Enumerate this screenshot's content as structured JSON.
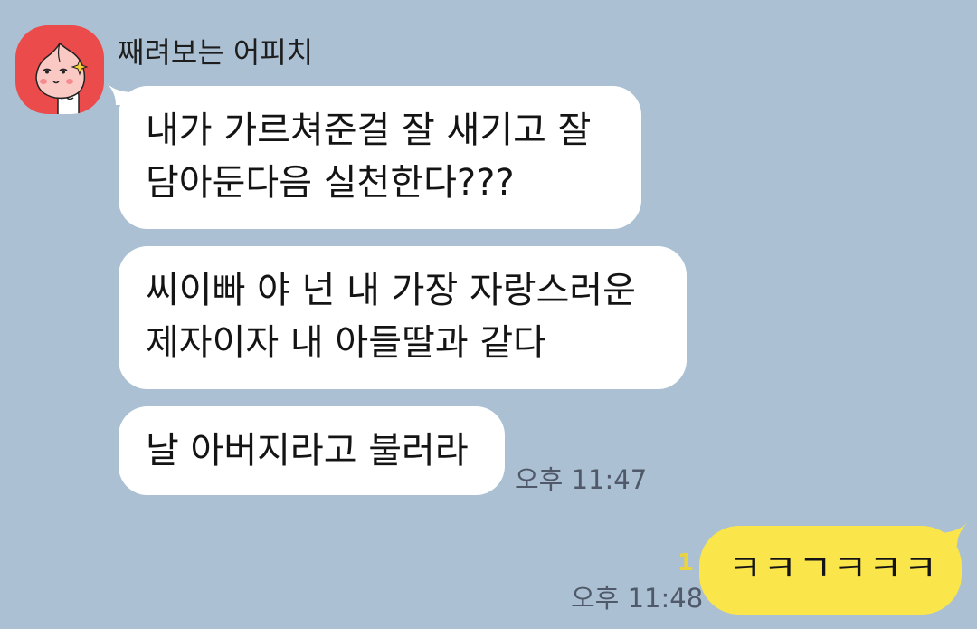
{
  "sender": {
    "name": "째려보는 어피치",
    "avatar_icon": "apeach-peach-icon",
    "avatar_bg": "#ec4b4b"
  },
  "incoming": [
    {
      "line1": "내가 가르쳐준걸 잘 새기고 잘",
      "line2": "담아둔다음 실천한다???"
    },
    {
      "line1": "씨이빠 야 넌 내 가장 자랑스러운",
      "line2": "제자이자 내 아들딸과 같다"
    },
    {
      "line1": "날 아버지라고 불러라"
    }
  ],
  "incoming_time": "오후 11:47",
  "outgoing": {
    "text": "ㅋㅋㄱㅋㅋㅋ",
    "unread_count": "1",
    "time": "오후 11:48",
    "bubble_color": "#fae64a"
  },
  "colors": {
    "background": "#abc0d2",
    "incoming_bubble": "#ffffff",
    "unread": "#ead33d"
  }
}
